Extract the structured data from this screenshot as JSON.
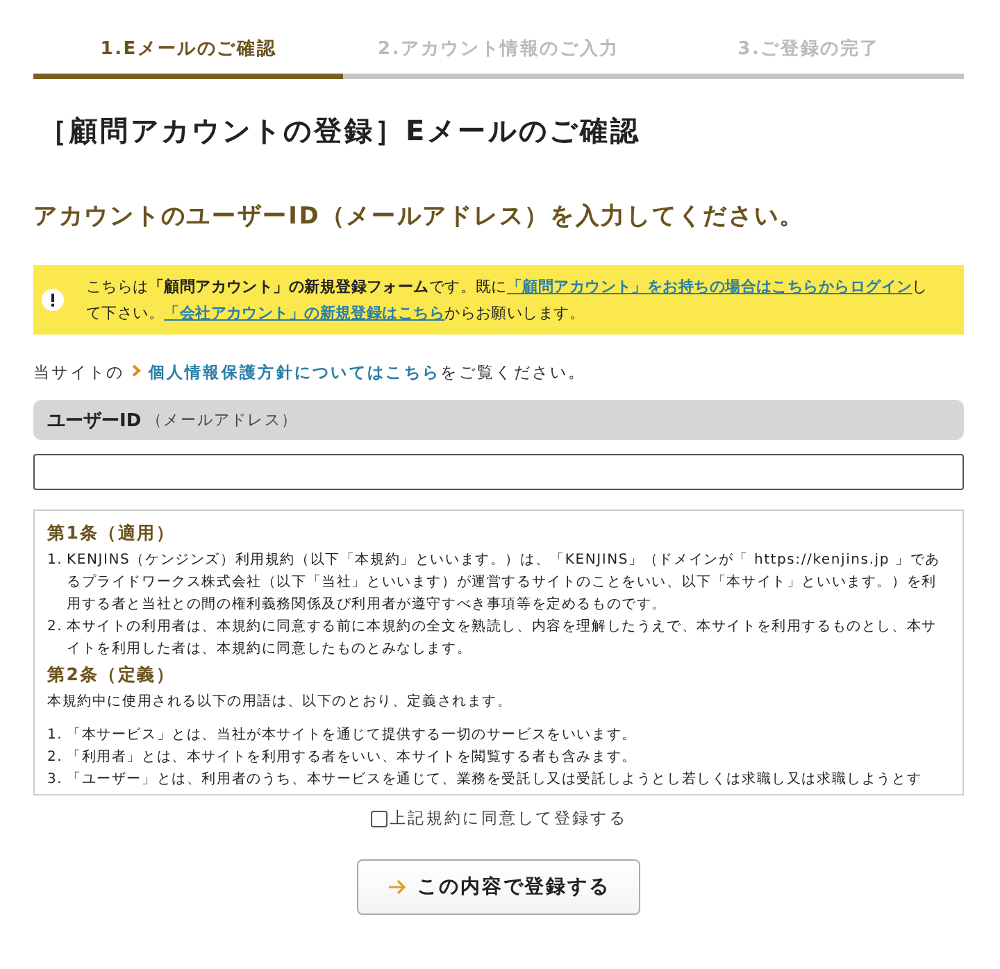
{
  "steps": [
    {
      "label": "1.Eメールのご確認",
      "selected": true
    },
    {
      "label": "2.アカウント情報のご入力",
      "selected": false
    },
    {
      "label": "3.ご登録の完了",
      "selected": false
    }
  ],
  "title": "［顧問アカウントの登録］Eメールのご確認",
  "subtitle": "アカウントのユーザーID（メールアドレス）を入力してください。",
  "notice": {
    "segments": [
      {
        "kind": "text",
        "text": "こちらは**「顧問アカウント」の新規登録フォーム**です。既に"
      },
      {
        "kind": "link",
        "text": "「顧問アカウント」をお持ちの場合はこちらか"
      },
      {
        "kind": "link",
        "text": "らログイン"
      },
      {
        "kind": "text",
        "text": "して下さい。"
      },
      {
        "kind": "link",
        "text": "「会社アカウント」の新規登録はこちら"
      },
      {
        "kind": "text",
        "text": "からお願いします。"
      }
    ]
  },
  "privacy": {
    "before": "当サイトの",
    "link": "個人情報保護方針についてはこちら",
    "after": "をご覧ください。"
  },
  "user_id": {
    "label": "ユーザーID",
    "hint": "（メールアドレス）"
  },
  "terms": [
    {
      "heading": "第1条（適用）",
      "blocks": [
        {
          "kind": "list",
          "items": [
            {
              "number": "1.",
              "text": "KENJINS（ケンジンズ）利用規約（以下「本規約」といいます。）は、「KENJINS」（ドメインが「 https://kenjins.jp 」であるプライドワークス株式会社（以下「当社」といいます）が運営するサイトのことをいい、以下「本サイト」といいます。）を利用する者と当社との間の権利義務関係及び利用者が遵守すべき事項等を定めるものです。"
            },
            {
              "number": "2.",
              "text": "本サイトの利用者は、本規約に同意する前に本規約の全文を熟読し、内容を理解したうえで、本サイトを利用するものとし、本サイトを利用した者は、本規約に同意したものとみなします。"
            }
          ]
        }
      ]
    },
    {
      "heading": "第2条（定義）",
      "blocks": [
        {
          "kind": "paragraph",
          "text": "本規約中に使用される以下の用語は、以下のとおり、定義されます。"
        },
        {
          "kind": "list",
          "items": [
            {
              "number": "1.",
              "text": "「本サービス」とは、当社が本サイトを通じて提供する一切のサービスをいいます。"
            },
            {
              "number": "2.",
              "text": "「利用者」とは、本サイトを利用する者をいい、本サイトを閲覧する者も含みます。"
            },
            {
              "number": "3.",
              "text": "「ユーザー」とは、利用者のうち、本サービスを通じて、業務を受託し又は受託しようとし若しくは求職し又は求職しようとす"
            }
          ]
        }
      ]
    }
  ],
  "agree": {
    "label": "上記規約に同意して登録する",
    "checked": false
  },
  "submit": {
    "label": "この内容で登録する"
  }
}
